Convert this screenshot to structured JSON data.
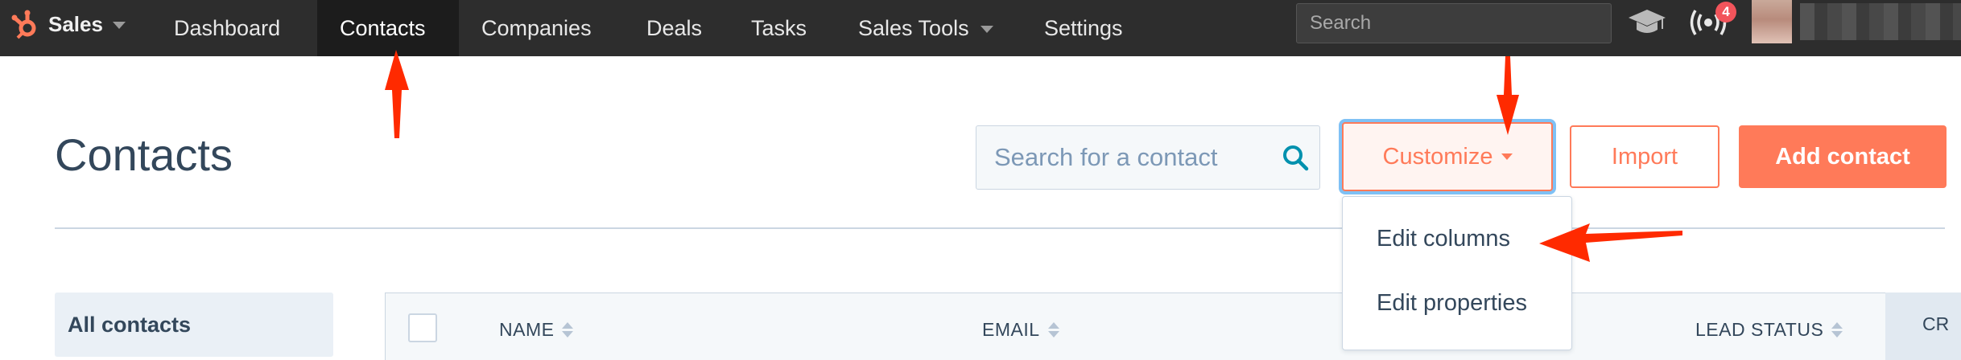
{
  "topnav": {
    "brand": "Sales",
    "items": [
      {
        "label": "Dashboard"
      },
      {
        "label": "Contacts",
        "active": true
      },
      {
        "label": "Companies"
      },
      {
        "label": "Deals"
      },
      {
        "label": "Tasks"
      },
      {
        "label": "Sales Tools",
        "has_dropdown": true
      },
      {
        "label": "Settings"
      }
    ],
    "search_placeholder": "Search",
    "notification_count": "4"
  },
  "page": {
    "title": "Contacts",
    "search_placeholder": "Search for a contact",
    "customize_label": "Customize",
    "import_label": "Import",
    "add_label": "Add contact"
  },
  "dropdown": {
    "items": [
      {
        "label": "Edit columns"
      },
      {
        "label": "Edit properties"
      }
    ]
  },
  "views": {
    "items": [
      {
        "label": "All contacts"
      }
    ]
  },
  "table": {
    "columns": [
      {
        "label": "NAME"
      },
      {
        "label": "EMAIL"
      },
      {
        "label": "LEAD STATUS"
      },
      {
        "label": "CR"
      }
    ]
  },
  "colors": {
    "nav_bg": "#2d2d2d",
    "accent": "#ff7a59",
    "text_dark": "#33475b",
    "annotation": "#ff2a00",
    "focus_ring": "#7fc1f5",
    "badge": "#f2545b"
  }
}
